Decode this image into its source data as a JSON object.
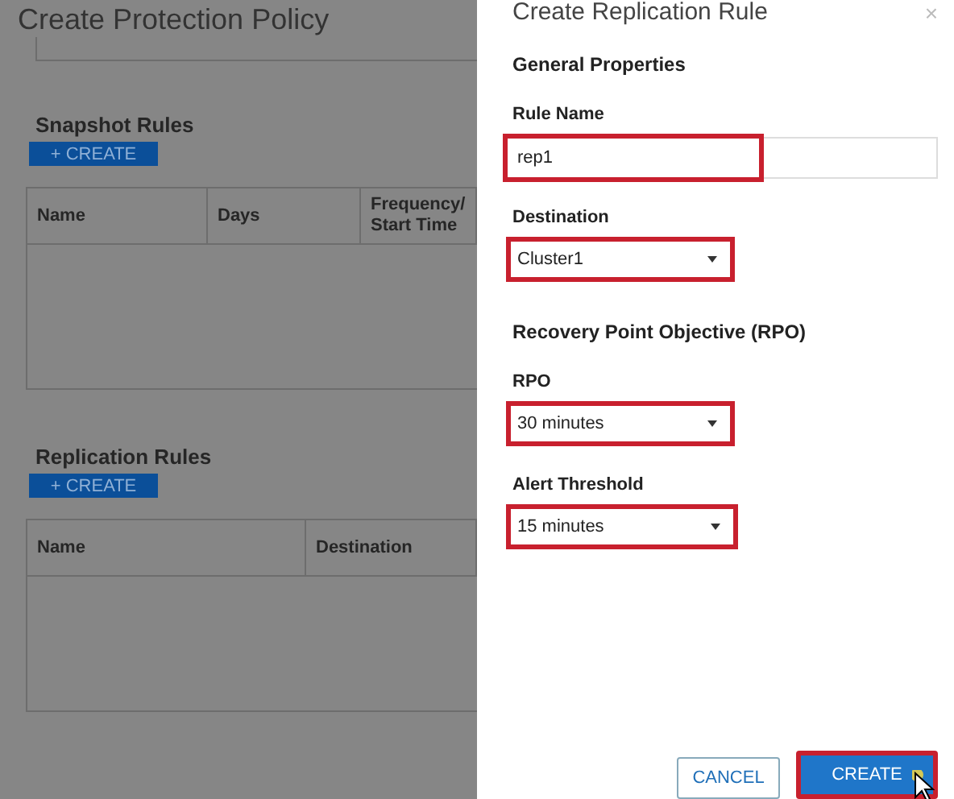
{
  "page": {
    "title": "Create Protection Policy"
  },
  "sections": [
    {
      "title": "Snapshot Rules",
      "button": "+ CREATE",
      "columns": [
        "Name",
        "Days",
        "Frequency/ Start Time"
      ]
    },
    {
      "title": "Replication Rules",
      "button": "+ CREATE",
      "columns": [
        "Name",
        "Destination"
      ]
    }
  ],
  "dialog": {
    "title": "Create Replication Rule",
    "close": "×",
    "section": "General Properties",
    "fields": [
      {
        "kind": "text",
        "label": "Rule Name",
        "value": "rep1",
        "highlighted": true
      },
      {
        "kind": "select",
        "label": "Destination",
        "value": "Cluster1",
        "highlighted": true
      },
      {
        "kind": "heading",
        "label": "Recovery Point Objective (RPO)"
      },
      {
        "kind": "select",
        "label": "RPO",
        "value": "30 minutes",
        "highlighted": true
      },
      {
        "kind": "select",
        "label": "Alert Threshold",
        "value": "15 minutes",
        "highlighted": true
      }
    ],
    "buttons": [
      {
        "kind": "secondary",
        "label": "CANCEL",
        "highlighted": false
      },
      {
        "kind": "primary",
        "label": "CREATE",
        "highlighted": true
      }
    ]
  }
}
